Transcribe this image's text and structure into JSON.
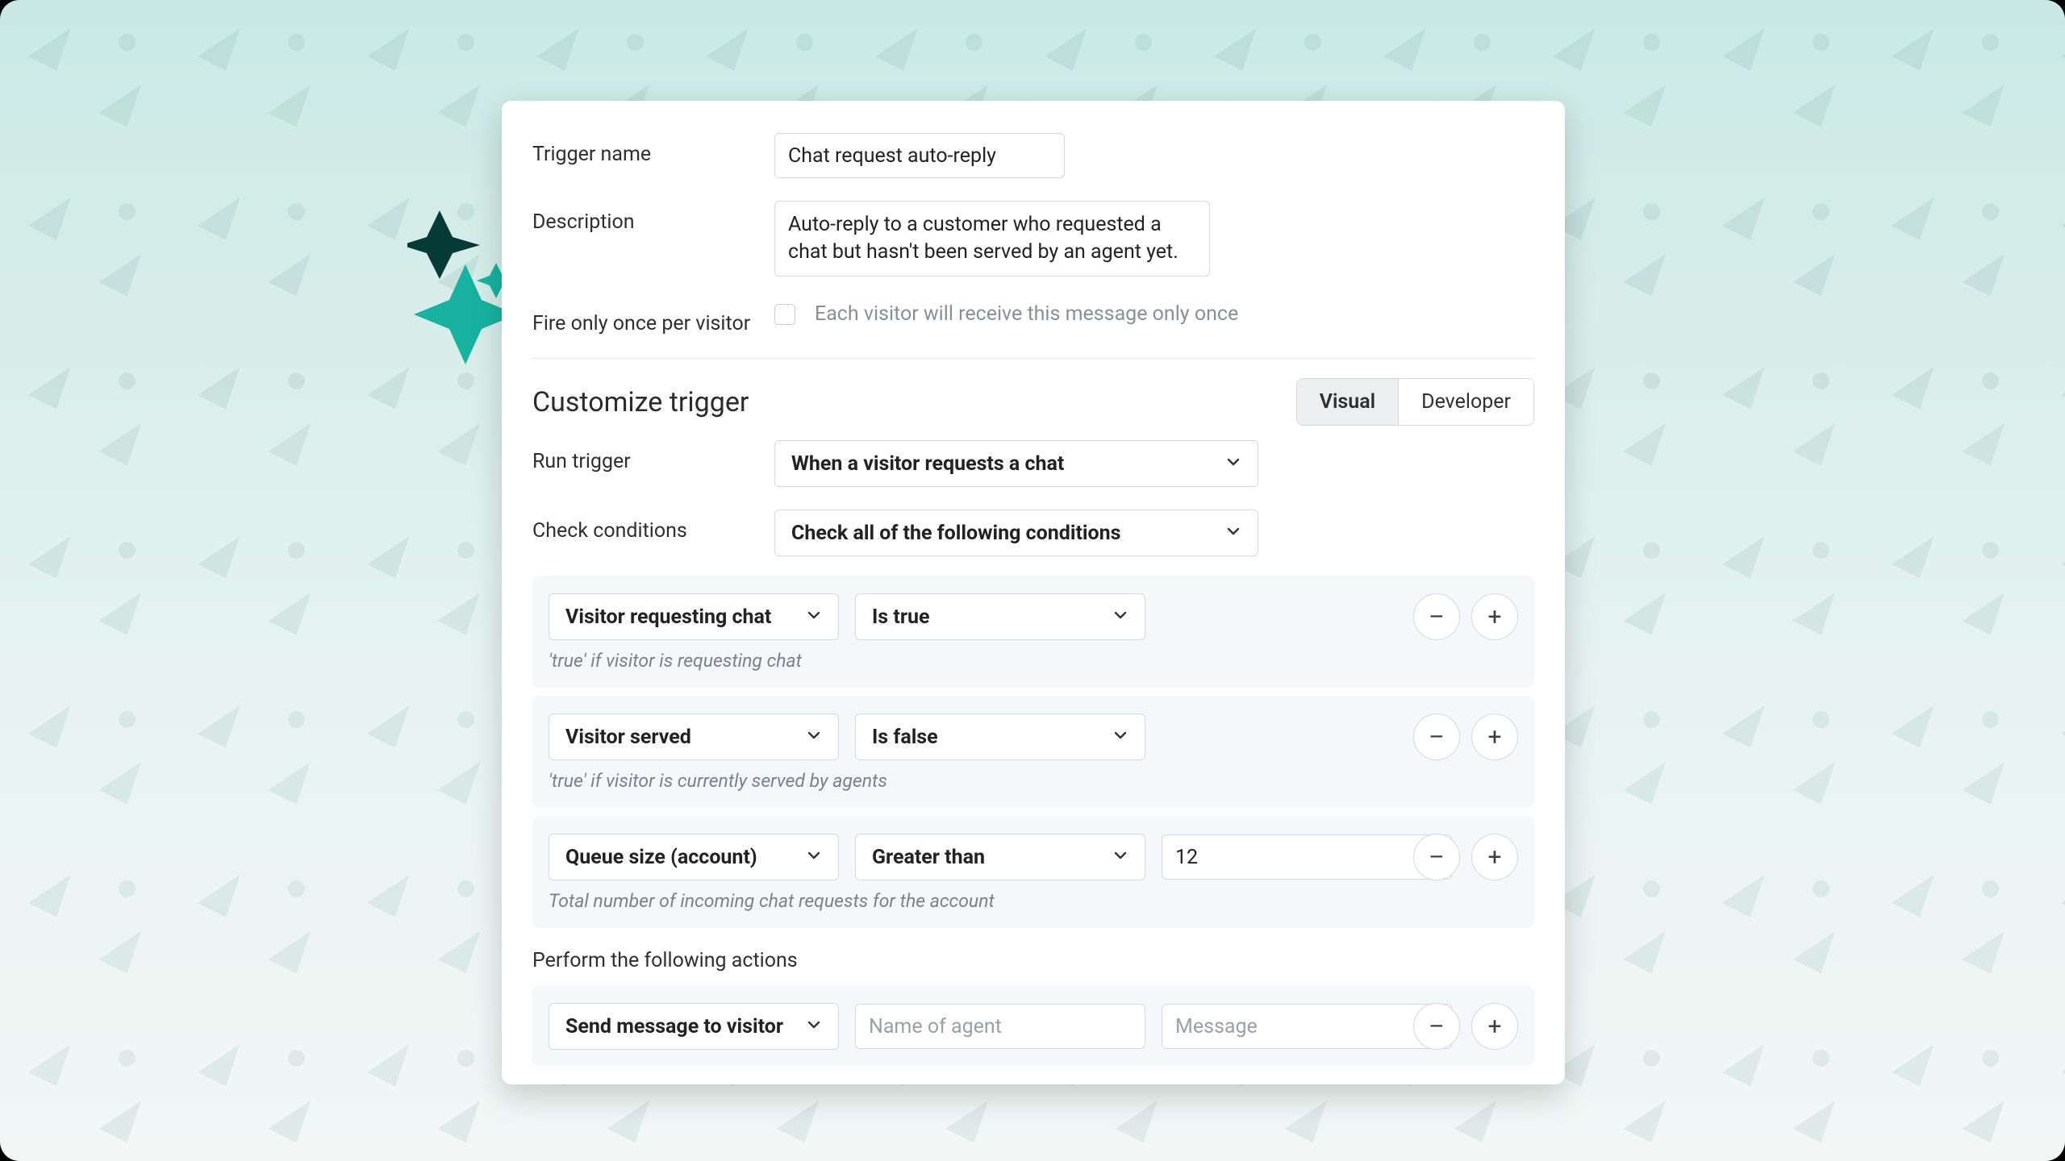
{
  "form": {
    "triggerNameLabel": "Trigger name",
    "triggerName": "Chat request auto-reply",
    "descriptionLabel": "Description",
    "description": "Auto-reply to a customer who requested a chat but hasn't been served by an agent yet.",
    "fireOnceLabel": "Fire only once per visitor",
    "fireOnceHint": "Each visitor will receive this message only once",
    "fireOnceChecked": false
  },
  "section": {
    "title": "Customize trigger",
    "toggle": {
      "visual": "Visual",
      "developer": "Developer",
      "active": "visual"
    },
    "runTriggerLabel": "Run trigger",
    "runTrigger": "When a visitor requests a chat",
    "checkConditionsLabel": "Check conditions",
    "checkConditions": "Check all of the following conditions"
  },
  "conditions": [
    {
      "field": "Visitor requesting chat",
      "op": "Is true",
      "value": "",
      "helper": "'true' if visitor is requesting chat"
    },
    {
      "field": "Visitor served",
      "op": "Is false",
      "value": "",
      "helper": "'true' if visitor is currently served by agents"
    },
    {
      "field": "Queue size (account)",
      "op": "Greater than",
      "value": "12",
      "helper": "Total number of incoming chat requests for the account"
    }
  ],
  "actions": {
    "label": "Perform the following actions",
    "item": {
      "action": "Send message to visitor",
      "agentPlaceholder": "Name of agent",
      "messagePlaceholder": "Message"
    }
  }
}
